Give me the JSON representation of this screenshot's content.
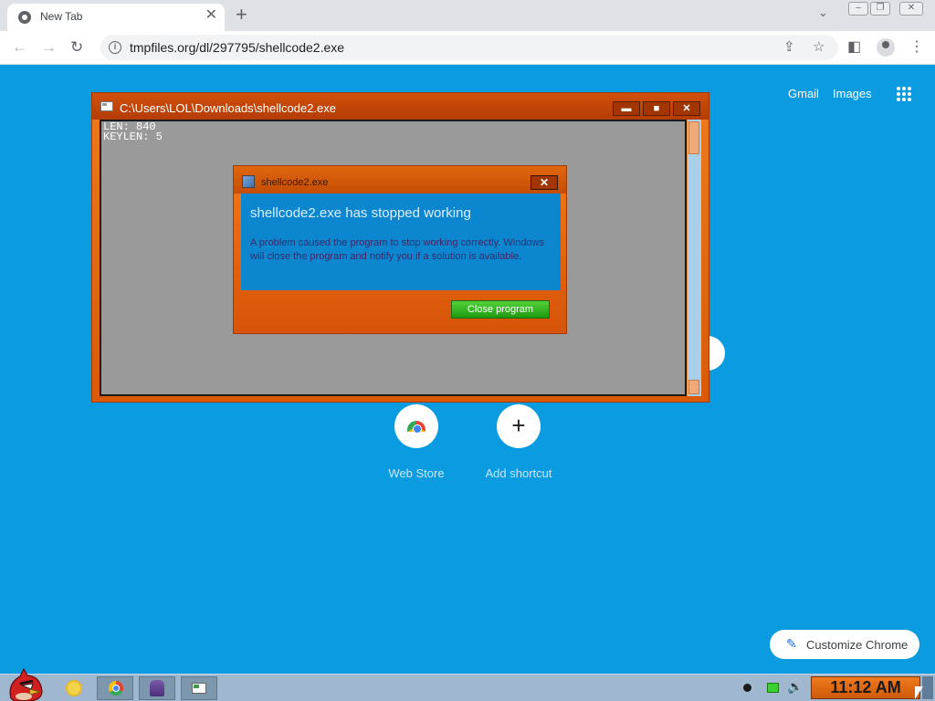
{
  "browser": {
    "tab_title": "New Tab",
    "tab_close": "✕",
    "new_tab": "+",
    "tab_search": "⌄",
    "window_controls": {
      "minimize": "‒",
      "restore": "❐",
      "close": "✕"
    },
    "nav": {
      "back": "←",
      "forward": "→",
      "reload": "↻"
    },
    "url": "tmpfiles.org/dl/297795/shellcode2.exe",
    "url_info_icon": "i",
    "share_icon": "⇪",
    "bookmark_icon": "☆",
    "sidepanel_icon": "◧",
    "menu_icon": "⋮"
  },
  "ntp": {
    "gmail": "Gmail",
    "images": "Images",
    "shortcuts": [
      {
        "label": "Web Store"
      },
      {
        "label": "Add shortcut",
        "symbol": "+"
      }
    ],
    "customize": "Customize Chrome",
    "customize_icon": "✎"
  },
  "console": {
    "title": "C:\\Users\\LOL\\Downloads\\shellcode2.exe",
    "lines": "LEN: 840\nKEYLEN: 5",
    "minimize": "▬",
    "maximize": "■",
    "close": "✕"
  },
  "dialog": {
    "title": "shellcode2.exe",
    "close": "✕",
    "heading": "shellcode2.exe has stopped working",
    "message": "A problem caused the program to stop working correctly. Windows will close the program and notify you if a solution is available.",
    "button": "Close program"
  },
  "taskbar": {
    "clock": "11:12 AM",
    "tray_icons": [
      "record-icon",
      "battery-icon",
      "volume-icon"
    ],
    "volume": "🔊"
  },
  "colors": {
    "page_bg": "#0a9be0",
    "window_orange": "#e2660f",
    "dialog_blue": "#0b86cf",
    "button_green": "#31b321"
  }
}
